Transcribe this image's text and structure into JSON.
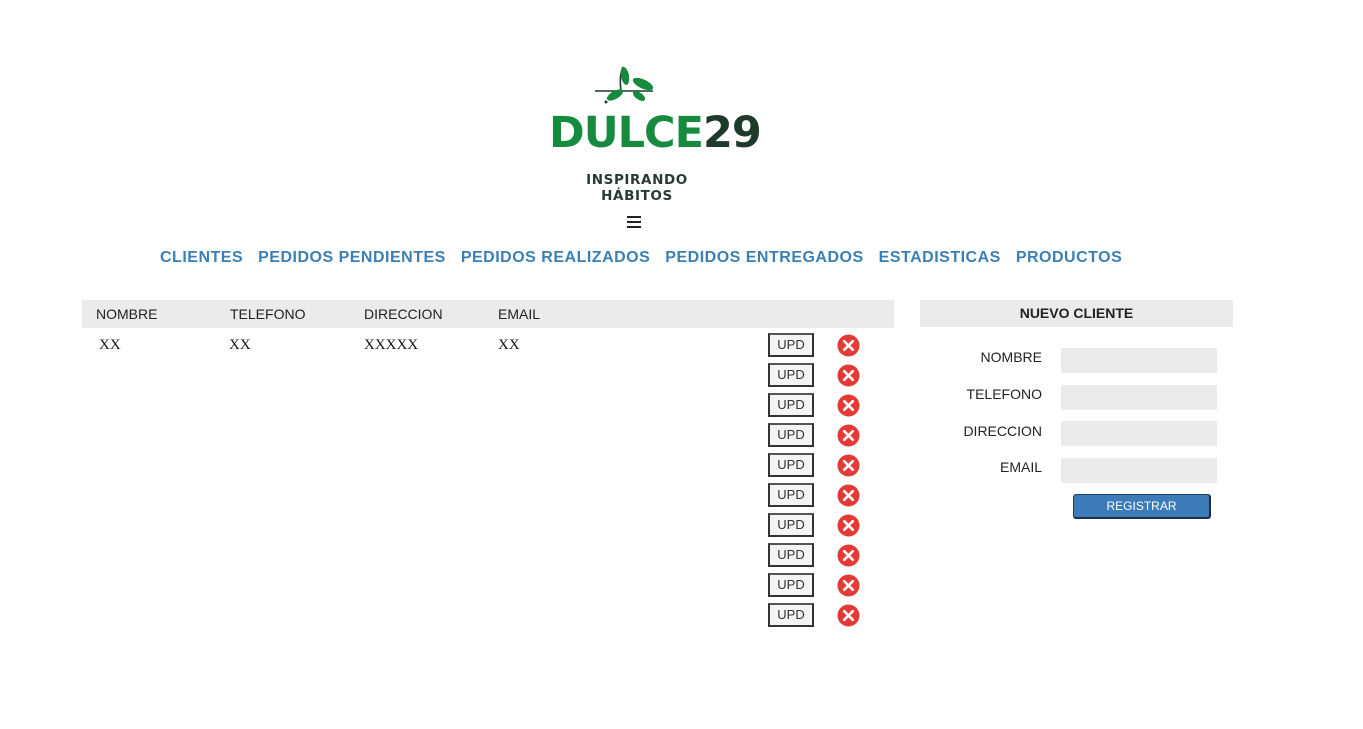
{
  "brand": {
    "name_part1": "DULCE",
    "name_part2": "29",
    "tagline": "INSPIRANDO HÁBITOS",
    "colors": {
      "green": "#168a3e",
      "dark": "#1e3a2a"
    }
  },
  "menu_icon": "hamburger-icon",
  "nav": {
    "items": [
      {
        "label": "CLIENTES"
      },
      {
        "label": "PEDIDOS PENDIENTES"
      },
      {
        "label": "PEDIDOS REALIZADOS"
      },
      {
        "label": "PEDIDOS ENTREGADOS"
      },
      {
        "label": "ESTADISTICAS"
      },
      {
        "label": "PRODUCTOS"
      }
    ],
    "color": "#3b7fb5"
  },
  "table": {
    "columns": [
      "NOMBRE",
      "TELEFONO",
      "DIRECCION",
      "EMAIL"
    ],
    "rows": [
      {
        "nombre": "XX",
        "telefono": "XX",
        "direccion": "XXXXX",
        "email": "XX"
      }
    ],
    "update_label": "UPD",
    "action_rows": 10,
    "delete_icon": "close-circle-icon",
    "delete_color": "#e53935"
  },
  "form": {
    "title": "NUEVO CLIENTE",
    "fields": [
      {
        "label": "NOMBRE",
        "value": ""
      },
      {
        "label": "TELEFONO",
        "value": ""
      },
      {
        "label": "DIRECCION",
        "value": ""
      },
      {
        "label": "EMAIL",
        "value": ""
      }
    ],
    "submit_label": "REGISTRAR",
    "submit_color": "#3d7ab8"
  }
}
